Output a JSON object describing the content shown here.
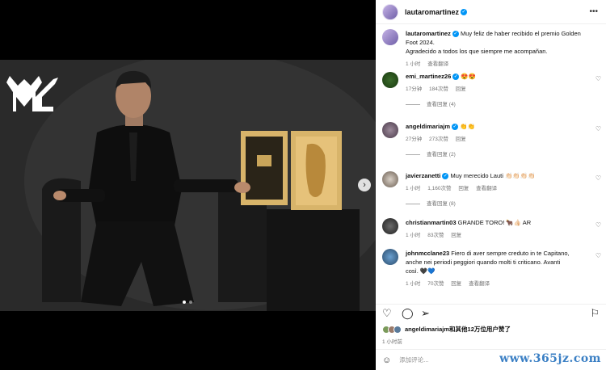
{
  "post": {
    "username": "lautaromartinez",
    "caption_line1": "Muy feliz de haber recibido el premio Golden",
    "caption_line2": "Foot 2024.",
    "caption_line3": "Agradecido a todos los que siempre me acompañan.",
    "caption_time": "1 小时",
    "translate": "查看翻译"
  },
  "comments": [
    {
      "user": "emi_martinez26",
      "text": "😍😍",
      "time": "17分钟",
      "likes": "184次赞",
      "reply": "回复",
      "replies": "查看回复 (4)"
    },
    {
      "user": "angeldimariajm",
      "text": "👏👏",
      "time": "27分钟",
      "likes": "273次赞",
      "reply": "回复",
      "replies": "查看回复 (2)"
    },
    {
      "user": "javierzanetti",
      "text": "Muy merecido Lauti 👏🏻👏🏻👏🏻👏🏻",
      "time": "1 小时",
      "likes": "1,160次赞",
      "reply": "回复",
      "translate": "查看翻译",
      "replies": "查看回复 (8)"
    },
    {
      "user": "christianmartin03",
      "text": "GRANDE TORO! 🐂👍🏻 AR",
      "time": "1 小时",
      "likes": "83次赞",
      "reply": "回复"
    },
    {
      "user": "johnmcclane23",
      "text1": "Fiero di aver sempre creduto in te Capitano,",
      "text2": "anche nei periodi peggiori quando molti ti criticano. Avanti",
      "text3": "così. 🖤💙",
      "time": "1 小时",
      "likes": "70次赞",
      "reply": "回复",
      "translate": "查看翻译"
    }
  ],
  "likes_summary": {
    "user": "angeldimariajm",
    "suffix": "和其他12万位用户赞了"
  },
  "post_time": "1 小时前",
  "add_comment_placeholder": "添加评论...",
  "watermark": "www.365jz.com",
  "icons": {
    "more": "more-icon",
    "heart": "heart-icon",
    "comment": "comment-icon",
    "share": "share-icon",
    "save": "bookmark-icon",
    "emoji": "emoji-icon",
    "next": "chevron-right-icon"
  },
  "colors": {
    "verified": "#0095f6",
    "watermark": "#3a7fc4"
  }
}
